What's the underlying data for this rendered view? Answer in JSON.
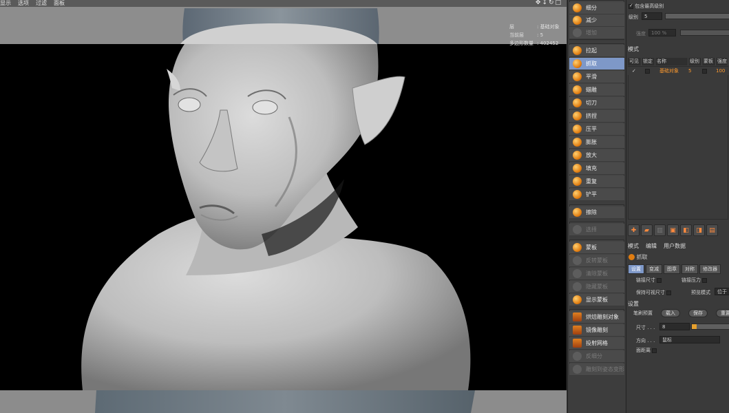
{
  "viewport": {
    "menu": [
      "显示",
      "选项",
      "过滤",
      "面板"
    ],
    "nav_icons": [
      "move-arrows-icon",
      "zoom-icon",
      "rotate-icon",
      "maximize-icon"
    ],
    "hud": {
      "rows": [
        {
          "key": "层",
          "value": ": 基础对象"
        },
        {
          "key": "当前层",
          "value": ": 5"
        },
        {
          "key": "多边形数量",
          "value": ": 402452"
        }
      ]
    }
  },
  "toolbar": {
    "items": [
      {
        "label": "细分",
        "icon": "subdivide-icon",
        "state": "normal"
      },
      {
        "label": "减少",
        "icon": "decrease-icon",
        "state": "normal"
      },
      {
        "label": "增加",
        "icon": "increase-icon",
        "state": "disabled"
      },
      {
        "label": "拉起",
        "icon": "pull-brush-icon",
        "state": "normal"
      },
      {
        "label": "抓取",
        "icon": "grab-brush-icon",
        "state": "selected"
      },
      {
        "label": "平滑",
        "icon": "smooth-brush-icon",
        "state": "normal"
      },
      {
        "label": "蜡雕",
        "icon": "wax-brush-icon",
        "state": "normal"
      },
      {
        "label": "切刀",
        "icon": "knife-brush-icon",
        "state": "normal"
      },
      {
        "label": "挤捏",
        "icon": "pinch-brush-icon",
        "state": "normal"
      },
      {
        "label": "压平",
        "icon": "flatten-brush-icon",
        "state": "normal"
      },
      {
        "label": "膨胀",
        "icon": "inflate-brush-icon",
        "state": "normal"
      },
      {
        "label": "放大",
        "icon": "magnify-brush-icon",
        "state": "normal"
      },
      {
        "label": "填充",
        "icon": "fill-brush-icon",
        "state": "normal"
      },
      {
        "label": "重复",
        "icon": "repeat-brush-icon",
        "state": "normal"
      },
      {
        "label": "铲平",
        "icon": "scrape-brush-icon",
        "state": "normal"
      },
      {
        "label": "擦除",
        "icon": "erase-brush-icon",
        "state": "normal"
      },
      {
        "label": "选择",
        "icon": "select-brush-icon",
        "state": "disabled"
      },
      {
        "label": "蒙板",
        "icon": "mask-brush-icon",
        "state": "normal"
      },
      {
        "label": "反转蒙板",
        "icon": "invert-mask-icon",
        "state": "disabled"
      },
      {
        "label": "清除蒙板",
        "icon": "clear-mask-icon",
        "state": "disabled"
      },
      {
        "label": "隐藏蒙板",
        "icon": "hide-mask-icon",
        "state": "disabled"
      },
      {
        "label": "显示蒙板",
        "icon": "show-mask-icon",
        "state": "normal"
      },
      {
        "label": "烘焙雕刻对象",
        "icon": "bake-object-icon",
        "state": "normal"
      },
      {
        "label": "镜像雕刻",
        "icon": "mirror-sculpt-icon",
        "state": "normal"
      },
      {
        "label": "投射网格",
        "icon": "project-mesh-icon",
        "state": "normal"
      },
      {
        "label": "反细分",
        "icon": "unsubdivide-icon",
        "state": "disabled"
      },
      {
        "label": "雕刻到姿态变形",
        "icon": "sculpt-to-pose-icon",
        "state": "disabled"
      }
    ]
  },
  "panel": {
    "include_highest": "包含最高级别",
    "level_label": "级别",
    "level_value": "5",
    "strength_label": "强度",
    "strength_value": "100 %",
    "mode_header": "模式",
    "layers_cols": [
      "可见",
      "锁定",
      "名称",
      "级别",
      "蒙板",
      "强度"
    ],
    "layer_row": {
      "name": "基础对象",
      "level": "5",
      "strength": "100"
    },
    "attr_menu": [
      "模式",
      "编辑",
      "用户数据"
    ],
    "tool_name": "抓取",
    "tabs": [
      "设置",
      "变减",
      "图章",
      "对称",
      "修改器"
    ],
    "link_size": "链接尺寸",
    "link_pressure": "链接压力",
    "keep_visible_size": "保持可视尺寸",
    "preview_mode": "预览模式",
    "preview_mode_value": "位于",
    "section_settings": "设置",
    "brush_preset": "笔刷预置",
    "load": "载入",
    "save": "保存",
    "reset": "重置",
    "size_label": "尺寸 . . .",
    "size_value": "8",
    "direction_label": "方向 . . .",
    "direction_value": "鼠标",
    "surface_distance": "面距离"
  },
  "colors": {
    "accent": "#7e98c8",
    "layer_name": "#ff9a2e",
    "viewport_bg": "#000000"
  }
}
